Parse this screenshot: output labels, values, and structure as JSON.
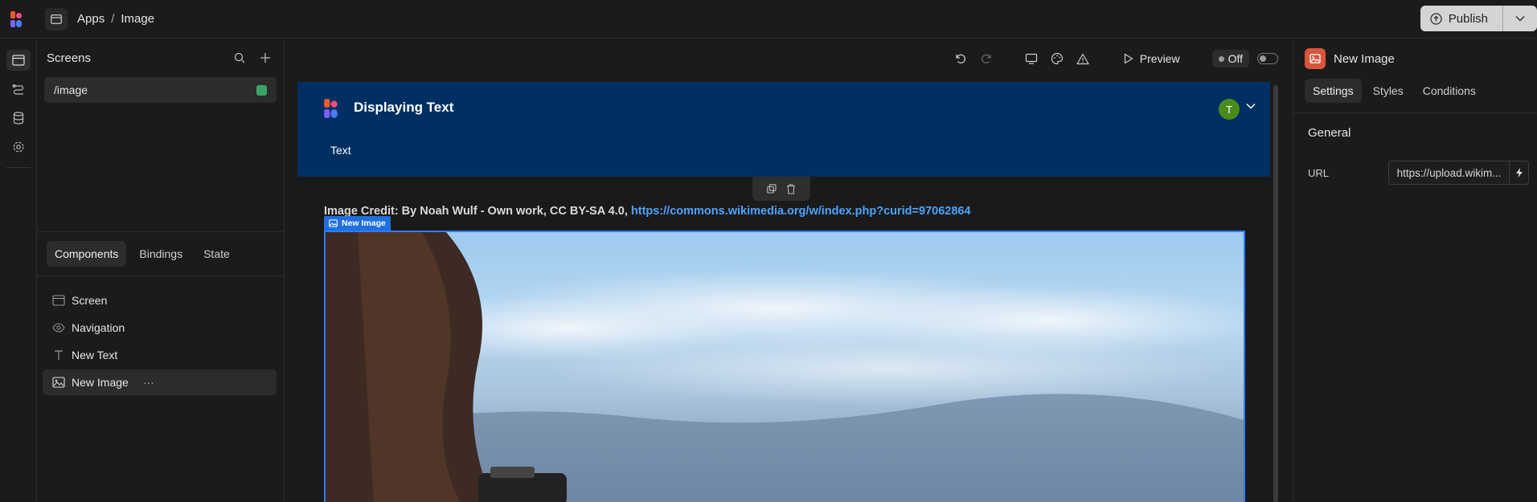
{
  "topbar": {
    "breadcrumb": [
      "Apps",
      "Image"
    ],
    "breadcrumb_sep": "/",
    "publish_label": "Publish"
  },
  "left_panel": {
    "screens_title": "Screens",
    "screens": [
      {
        "route": "/image",
        "status_color": "#3aa56b"
      }
    ],
    "tabs": [
      "Components",
      "Bindings",
      "State"
    ],
    "active_tab": "Components",
    "tree": [
      {
        "label": "Screen",
        "icon": "screen-icon"
      },
      {
        "label": "Navigation",
        "icon": "eye-icon"
      },
      {
        "label": "New Text",
        "icon": "text-icon"
      },
      {
        "label": "New Image",
        "icon": "image-icon",
        "selected": true,
        "more": "···"
      }
    ]
  },
  "toolbar": {
    "preview_label": "Preview",
    "toggle_label": "Off"
  },
  "app_preview": {
    "app_title": "Displaying Text",
    "avatar_initial": "T",
    "avatar_color": "#4a8c1c",
    "nav_bg": "#002f63",
    "nav_links": [
      "Text"
    ],
    "credit_prefix": "Image Credit: By Noah Wulf - Own work, CC BY-SA 4.0, ",
    "credit_link": "https://commons.wikimedia.org/w/index.php?curid=97062864",
    "selected_component_label": "New Image"
  },
  "right_panel": {
    "component_title": "New Image",
    "tabs": [
      "Settings",
      "Styles",
      "Conditions"
    ],
    "active_tab": "Settings",
    "section_title": "General",
    "url_label": "URL",
    "url_value": "https://upload.wikim..."
  }
}
